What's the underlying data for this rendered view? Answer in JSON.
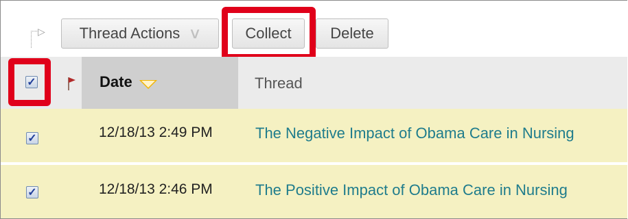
{
  "toolbar": {
    "thread_actions_label": "Thread Actions",
    "collect_label": "Collect",
    "delete_label": "Delete"
  },
  "table": {
    "columns": [
      "Date",
      "Thread"
    ],
    "rows": [
      {
        "date": "12/18/13 2:49 PM",
        "thread": "The Negative Impact of Obama Care in Nursing",
        "checked": true
      },
      {
        "date": "12/18/13 2:46 PM",
        "thread": "The Positive Impact of Obama Care in Nursing",
        "checked": true
      }
    ]
  },
  "select_all_checked": true,
  "colors": {
    "highlight": "#e0001a",
    "row_background": "#f5f1c2",
    "thread_link": "#1f7c8c",
    "sort_indicator": "#f2b400"
  },
  "icons": [
    "chevron-double-down-icon",
    "flag-icon",
    "sort-desc-icon",
    "dotted-arrow-icon"
  ]
}
